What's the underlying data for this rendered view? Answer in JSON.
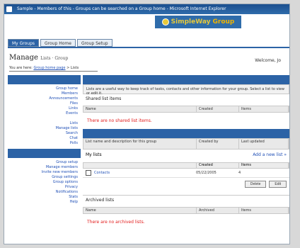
{
  "window": {
    "title": "Sample - Members of this - Groups can be searched on a Group home - Microsoft Internet Explorer"
  },
  "logo": {
    "brand": "SimpleWay",
    "suffix": "Group"
  },
  "tabs": [
    {
      "label": "My Groups",
      "active": true
    },
    {
      "label": "Group Home",
      "active": false
    },
    {
      "label": "Group Setup",
      "active": false
    }
  ],
  "header": {
    "title": "Manage",
    "subtitle": "Lists · Group",
    "welcome": "Welcome, Jo",
    "breadcrumb_prefix": "You are here:",
    "breadcrumb_link": "Group home page",
    "breadcrumb_suffix": "> Lists"
  },
  "sidebar": {
    "items1": [
      "Group home",
      "Members",
      "Announcements",
      "Files",
      "Links",
      "Events",
      "",
      "Lists",
      "Manage lists",
      "Search",
      "Chat",
      "Polls"
    ],
    "items2": [
      "Group setup",
      "Manage members",
      "Invite new members",
      "Group settings",
      "Group options",
      "Privacy",
      "Notifications",
      "Stats",
      "Help"
    ]
  },
  "content": {
    "info_text": "Lists are a useful way to keep track of tasks, contacts and other information for your group. Select a list to view or edit it.",
    "section1_label": "Shared list items",
    "columns1": [
      "Name",
      "Created",
      "Items"
    ],
    "empty1": "There are no shared list items.",
    "columns2": [
      "List name and description for this group",
      "Created by",
      "Last updated"
    ],
    "lists_label": "My lists",
    "add_link": "Add a new list »",
    "row_head": [
      "",
      "Created",
      "Items"
    ],
    "list_rows": [
      {
        "name": "Contacts",
        "created": "05/22/2005",
        "items": "4"
      }
    ],
    "buttons": [
      "Delete",
      "Edit"
    ],
    "section3_label": "Archived lists",
    "columns3": [
      "Name",
      "Archived",
      "Items"
    ],
    "empty3": "There are no archived lists."
  },
  "colors": {
    "nav_blue": "#2c63a6",
    "link_blue": "#1f4fb6",
    "error_red": "#e21b1b",
    "logo_gold": "#e8c93a"
  }
}
